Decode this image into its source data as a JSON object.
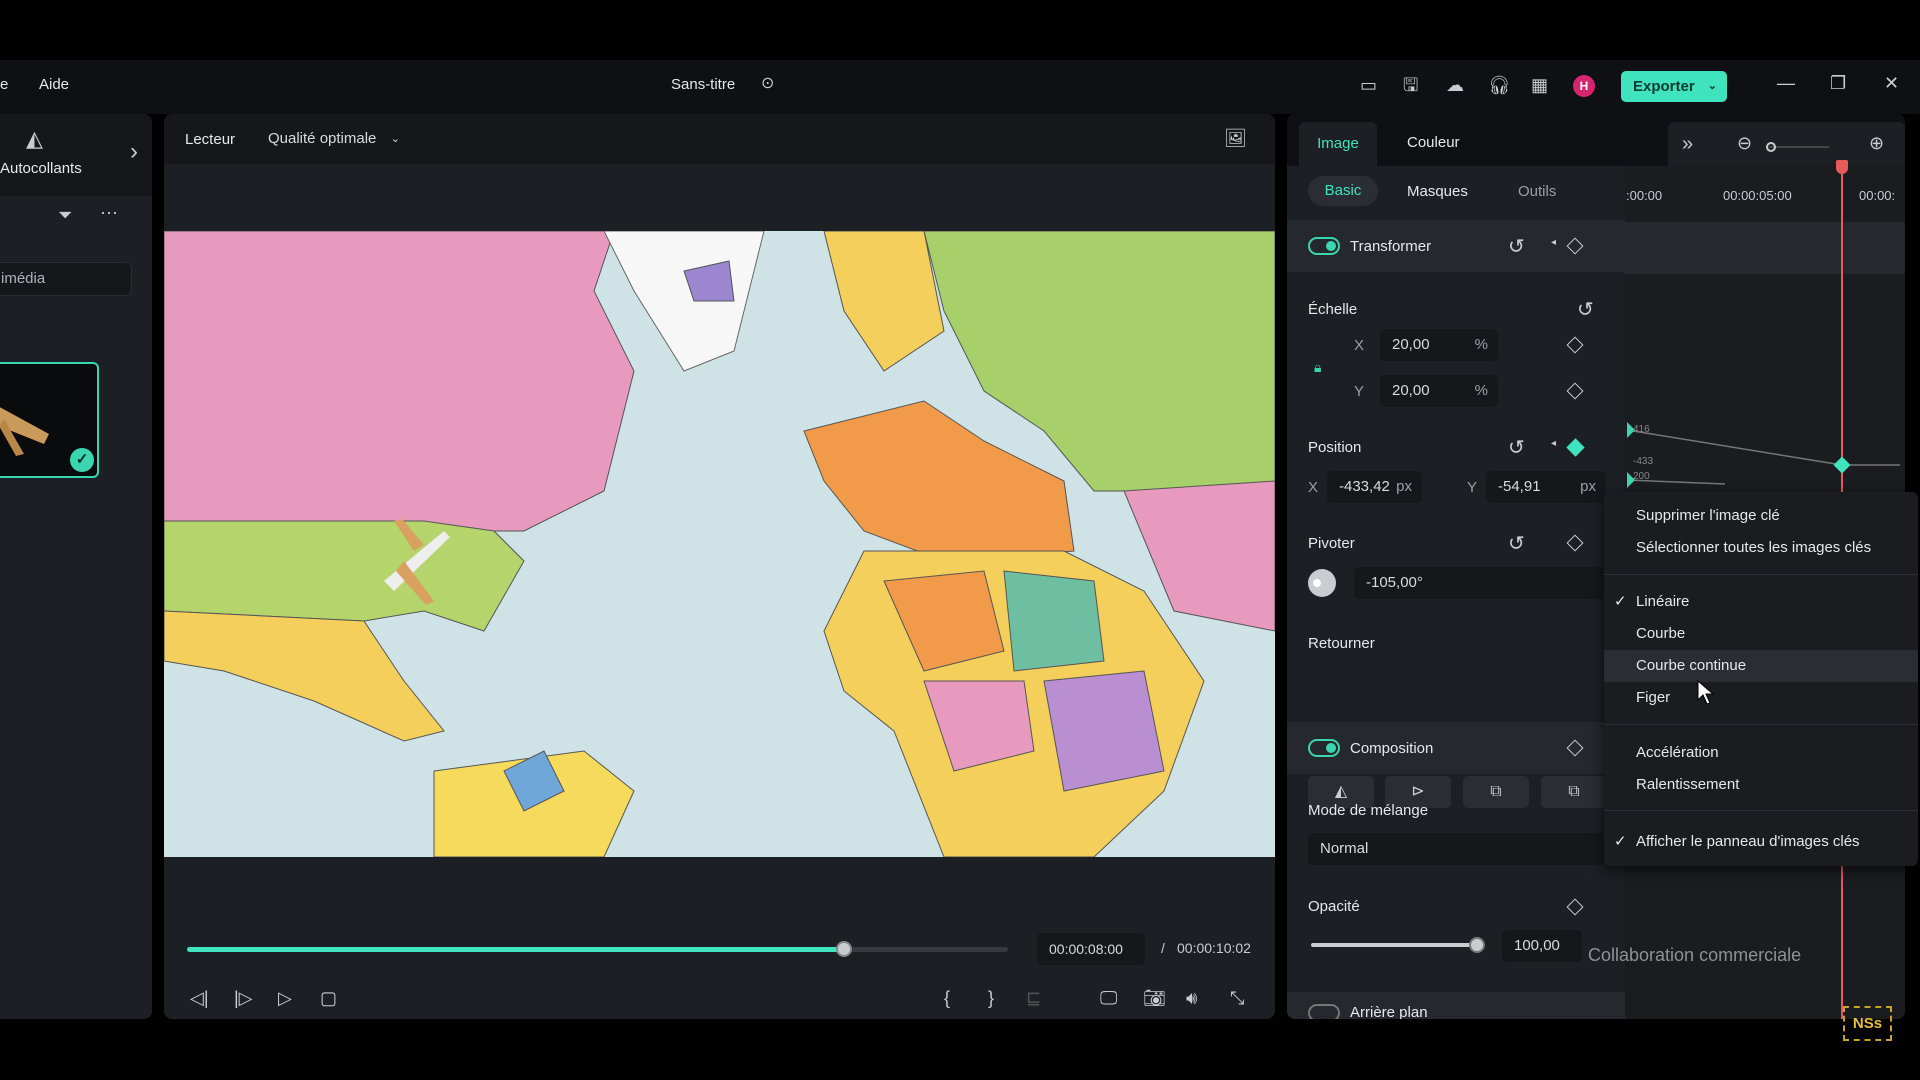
{
  "menu_bar": {
    "partial_item": "e",
    "help": "Aide"
  },
  "title": "Sans-titre",
  "toolbar": {
    "export_label": "Exporter",
    "avatar_initial": "H",
    "accent": "#3fe3bd"
  },
  "left_panel": {
    "stickers_label": "Autocollants",
    "search_placeholder_partial": "imédia"
  },
  "player": {
    "label": "Lecteur",
    "quality": "Qualité optimale",
    "current_time": "00:00:08:00",
    "separator": "/",
    "total_time": "00:00:10:02",
    "progress_percent": 80
  },
  "properties": {
    "tabs": [
      "Image",
      "Couleur"
    ],
    "subtabs": [
      "Basic",
      "Masques",
      "Outils"
    ],
    "transform_label": "Transformer",
    "scale_label": "Échelle",
    "scale_x": "20,00",
    "scale_y": "20,00",
    "percent": "%",
    "x_label": "X",
    "y_label": "Y",
    "position_label": "Position",
    "pos_x": "-433,42",
    "pos_y": "-54,91",
    "px": "px",
    "rotate_label": "Pivoter",
    "rotate_value": "-105,00°",
    "flip_label": "Retourner",
    "composition_label": "Composition",
    "blend_label": "Mode de mélange",
    "blend_value": "Normal",
    "opacity_label": "Opacité",
    "opacity_value": "100,00",
    "opacity_percent": 100,
    "background_label": "Arrière plan"
  },
  "keyframe_timeline": {
    "ruler": [
      ":00:00",
      "00:00:05:00",
      "00:00:"
    ],
    "graph_labels": [
      "416",
      "-433",
      "200"
    ],
    "playhead_color": "#e85a5a"
  },
  "context_menu": {
    "items": [
      {
        "label": "Supprimer l'image clé",
        "checked": false
      },
      {
        "label": "Sélectionner toutes les images clés",
        "checked": false
      },
      {
        "label": "Linéaire",
        "checked": true
      },
      {
        "label": "Courbe",
        "checked": false
      },
      {
        "label": "Courbe continue",
        "checked": false,
        "hovered": true
      },
      {
        "label": "Figer",
        "checked": false
      },
      {
        "label": "Accélération",
        "checked": false
      },
      {
        "label": "Ralentissement",
        "checked": false
      },
      {
        "label": "Afficher le panneau d'images clés",
        "checked": true
      }
    ],
    "check_mark": "✓"
  },
  "overlay_text": "Collaboration commerciale",
  "watermark_logo": "NSs"
}
